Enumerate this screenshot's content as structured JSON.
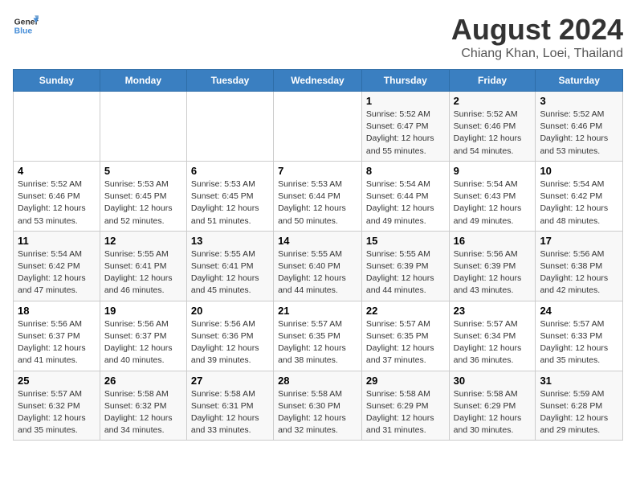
{
  "header": {
    "logo_line1": "General",
    "logo_line2": "Blue",
    "month": "August 2024",
    "location": "Chiang Khan, Loei, Thailand"
  },
  "days_of_week": [
    "Sunday",
    "Monday",
    "Tuesday",
    "Wednesday",
    "Thursday",
    "Friday",
    "Saturday"
  ],
  "weeks": [
    [
      {
        "day": "",
        "info": ""
      },
      {
        "day": "",
        "info": ""
      },
      {
        "day": "",
        "info": ""
      },
      {
        "day": "",
        "info": ""
      },
      {
        "day": "1",
        "info": "Sunrise: 5:52 AM\nSunset: 6:47 PM\nDaylight: 12 hours\nand 55 minutes."
      },
      {
        "day": "2",
        "info": "Sunrise: 5:52 AM\nSunset: 6:46 PM\nDaylight: 12 hours\nand 54 minutes."
      },
      {
        "day": "3",
        "info": "Sunrise: 5:52 AM\nSunset: 6:46 PM\nDaylight: 12 hours\nand 53 minutes."
      }
    ],
    [
      {
        "day": "4",
        "info": "Sunrise: 5:52 AM\nSunset: 6:46 PM\nDaylight: 12 hours\nand 53 minutes."
      },
      {
        "day": "5",
        "info": "Sunrise: 5:53 AM\nSunset: 6:45 PM\nDaylight: 12 hours\nand 52 minutes."
      },
      {
        "day": "6",
        "info": "Sunrise: 5:53 AM\nSunset: 6:45 PM\nDaylight: 12 hours\nand 51 minutes."
      },
      {
        "day": "7",
        "info": "Sunrise: 5:53 AM\nSunset: 6:44 PM\nDaylight: 12 hours\nand 50 minutes."
      },
      {
        "day": "8",
        "info": "Sunrise: 5:54 AM\nSunset: 6:44 PM\nDaylight: 12 hours\nand 49 minutes."
      },
      {
        "day": "9",
        "info": "Sunrise: 5:54 AM\nSunset: 6:43 PM\nDaylight: 12 hours\nand 49 minutes."
      },
      {
        "day": "10",
        "info": "Sunrise: 5:54 AM\nSunset: 6:42 PM\nDaylight: 12 hours\nand 48 minutes."
      }
    ],
    [
      {
        "day": "11",
        "info": "Sunrise: 5:54 AM\nSunset: 6:42 PM\nDaylight: 12 hours\nand 47 minutes."
      },
      {
        "day": "12",
        "info": "Sunrise: 5:55 AM\nSunset: 6:41 PM\nDaylight: 12 hours\nand 46 minutes."
      },
      {
        "day": "13",
        "info": "Sunrise: 5:55 AM\nSunset: 6:41 PM\nDaylight: 12 hours\nand 45 minutes."
      },
      {
        "day": "14",
        "info": "Sunrise: 5:55 AM\nSunset: 6:40 PM\nDaylight: 12 hours\nand 44 minutes."
      },
      {
        "day": "15",
        "info": "Sunrise: 5:55 AM\nSunset: 6:39 PM\nDaylight: 12 hours\nand 44 minutes."
      },
      {
        "day": "16",
        "info": "Sunrise: 5:56 AM\nSunset: 6:39 PM\nDaylight: 12 hours\nand 43 minutes."
      },
      {
        "day": "17",
        "info": "Sunrise: 5:56 AM\nSunset: 6:38 PM\nDaylight: 12 hours\nand 42 minutes."
      }
    ],
    [
      {
        "day": "18",
        "info": "Sunrise: 5:56 AM\nSunset: 6:37 PM\nDaylight: 12 hours\nand 41 minutes."
      },
      {
        "day": "19",
        "info": "Sunrise: 5:56 AM\nSunset: 6:37 PM\nDaylight: 12 hours\nand 40 minutes."
      },
      {
        "day": "20",
        "info": "Sunrise: 5:56 AM\nSunset: 6:36 PM\nDaylight: 12 hours\nand 39 minutes."
      },
      {
        "day": "21",
        "info": "Sunrise: 5:57 AM\nSunset: 6:35 PM\nDaylight: 12 hours\nand 38 minutes."
      },
      {
        "day": "22",
        "info": "Sunrise: 5:57 AM\nSunset: 6:35 PM\nDaylight: 12 hours\nand 37 minutes."
      },
      {
        "day": "23",
        "info": "Sunrise: 5:57 AM\nSunset: 6:34 PM\nDaylight: 12 hours\nand 36 minutes."
      },
      {
        "day": "24",
        "info": "Sunrise: 5:57 AM\nSunset: 6:33 PM\nDaylight: 12 hours\nand 35 minutes."
      }
    ],
    [
      {
        "day": "25",
        "info": "Sunrise: 5:57 AM\nSunset: 6:32 PM\nDaylight: 12 hours\nand 35 minutes."
      },
      {
        "day": "26",
        "info": "Sunrise: 5:58 AM\nSunset: 6:32 PM\nDaylight: 12 hours\nand 34 minutes."
      },
      {
        "day": "27",
        "info": "Sunrise: 5:58 AM\nSunset: 6:31 PM\nDaylight: 12 hours\nand 33 minutes."
      },
      {
        "day": "28",
        "info": "Sunrise: 5:58 AM\nSunset: 6:30 PM\nDaylight: 12 hours\nand 32 minutes."
      },
      {
        "day": "29",
        "info": "Sunrise: 5:58 AM\nSunset: 6:29 PM\nDaylight: 12 hours\nand 31 minutes."
      },
      {
        "day": "30",
        "info": "Sunrise: 5:58 AM\nSunset: 6:29 PM\nDaylight: 12 hours\nand 30 minutes."
      },
      {
        "day": "31",
        "info": "Sunrise: 5:59 AM\nSunset: 6:28 PM\nDaylight: 12 hours\nand 29 minutes."
      }
    ]
  ]
}
